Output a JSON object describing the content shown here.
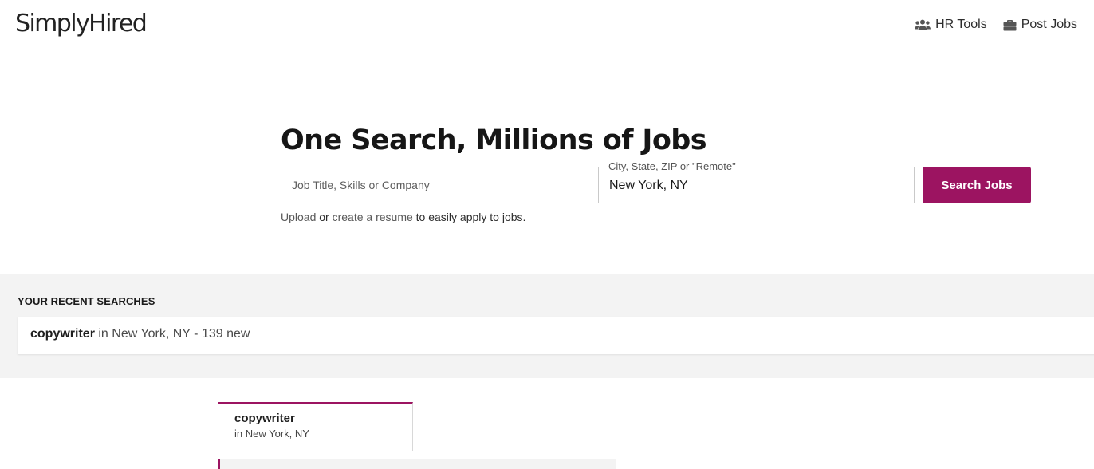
{
  "header": {
    "logo": "SimplyHired",
    "nav": [
      {
        "icon": "users-icon",
        "label": "HR Tools"
      },
      {
        "icon": "briefcase-icon",
        "label": "Post Jobs"
      }
    ]
  },
  "hero": {
    "title": "One Search, Millions of Jobs",
    "what_placeholder": "Job Title, Skills or Company",
    "where_label": "City, State, ZIP or \"Remote\"",
    "where_value": "New York, NY",
    "search_button": "Search Jobs",
    "resume_line": {
      "upload": "Upload",
      "or": "or",
      "create": "create a resume",
      "rest": "to easily apply to jobs."
    }
  },
  "recent": {
    "title": "YOUR RECENT SEARCHES",
    "items": [
      {
        "query": "copywriter",
        "in": "in",
        "location": "New York, NY",
        "sep": "-",
        "count": "139 new"
      }
    ]
  },
  "tabs": [
    {
      "query": "copywriter",
      "location": "in New York, NY"
    }
  ],
  "colors": {
    "brand": "#9c1461",
    "band_bg": "#f3f3f3"
  }
}
